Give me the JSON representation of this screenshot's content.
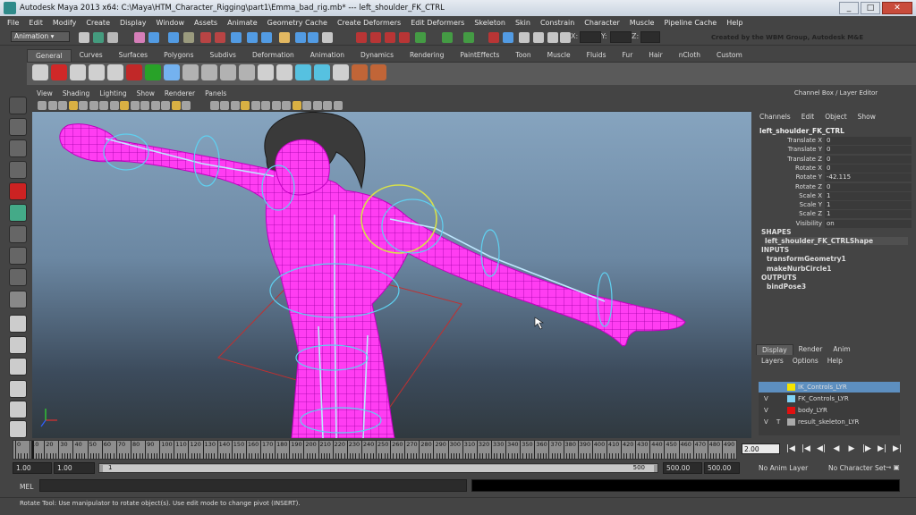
{
  "title": "Autodesk Maya 2013 x64: C:\\Maya\\HTM_Character_Rigging\\part1\\Emma_bad_rig.mb*   ---   left_shoulder_FK_CTRL",
  "menus": [
    "File",
    "Edit",
    "Modify",
    "Create",
    "Display",
    "Window",
    "Assets",
    "Animate",
    "Geometry Cache",
    "Create Deformers",
    "Edit Deformers",
    "Skeleton",
    "Skin",
    "Constrain",
    "Character",
    "Muscle",
    "Pipeline Cache",
    "Help"
  ],
  "status": {
    "mode": "Animation",
    "x_label": "X:",
    "y_label": "Y:",
    "z_label": "Z:",
    "credit": "Created by the WBM Group, Autodesk M&E"
  },
  "shelf_tabs": [
    "General",
    "Curves",
    "Surfaces",
    "Polygons",
    "Subdivs",
    "Deformation",
    "Animation",
    "Dynamics",
    "Rendering",
    "PaintEffects",
    "Toon",
    "Muscle",
    "Fluids",
    "Fur",
    "Hair",
    "nCloth",
    "Custom"
  ],
  "viewport_menu": [
    "View",
    "Shading",
    "Lighting",
    "Show",
    "Renderer",
    "Panels"
  ],
  "channel_box": {
    "title": "Channel Box / Layer Editor",
    "menu": [
      "Channels",
      "Edit",
      "Object",
      "Show"
    ],
    "object": "left_shoulder_FK_CTRL",
    "attributes": [
      {
        "name": "Translate X",
        "value": "0"
      },
      {
        "name": "Translate Y",
        "value": "0"
      },
      {
        "name": "Translate Z",
        "value": "0"
      },
      {
        "name": "Rotate X",
        "value": "0"
      },
      {
        "name": "Rotate Y",
        "value": "-42.115"
      },
      {
        "name": "Rotate Z",
        "value": "0"
      },
      {
        "name": "Scale X",
        "value": "1"
      },
      {
        "name": "Scale Y",
        "value": "1"
      },
      {
        "name": "Scale Z",
        "value": "1"
      },
      {
        "name": "Visibility",
        "value": "on"
      }
    ],
    "shapes_label": "SHAPES",
    "shape": "left_shoulder_FK_CTRLShape",
    "inputs_label": "INPUTS",
    "inputs": [
      "transformGeometry1",
      "makeNurbCircle1"
    ],
    "outputs_label": "OUTPUTS",
    "outputs": [
      "bindPose3"
    ]
  },
  "layer_editor": {
    "tabs": [
      "Display",
      "Render",
      "Anim"
    ],
    "menu": [
      "Layers",
      "Options",
      "Help"
    ],
    "layers": [
      {
        "vis": "",
        "type": "",
        "color": "#f5e400",
        "name": "IK_Controls_LYR"
      },
      {
        "vis": "V",
        "type": "",
        "color": "#7fd3f5",
        "name": "FK_Controls_LYR"
      },
      {
        "vis": "V",
        "type": "",
        "color": "#e01010",
        "name": "body_LYR"
      },
      {
        "vis": "V",
        "type": "T",
        "color": "#aaaaaa",
        "name": "result_skeleton_LYR"
      }
    ]
  },
  "timeline": {
    "ticks": [
      "0",
      "10",
      "20",
      "30",
      "40",
      "50",
      "60",
      "70",
      "80",
      "90",
      "100",
      "110",
      "120",
      "130",
      "140",
      "150",
      "160",
      "170",
      "180",
      "190",
      "200",
      "210",
      "220",
      "230",
      "240",
      "250",
      "260",
      "270",
      "280",
      "290",
      "300",
      "310",
      "320",
      "330",
      "340",
      "350",
      "360",
      "370",
      "380",
      "390",
      "400",
      "410",
      "420",
      "430",
      "440",
      "450",
      "460",
      "470",
      "480",
      "490"
    ],
    "current_frame": "2.00"
  },
  "range": {
    "start_outer": "1.00",
    "start_inner": "1.00",
    "bar_start": "1",
    "bar_end": "500",
    "end_inner": "500.00",
    "end_outer": "500.00",
    "anim_layer": "No Anim Layer",
    "char_set": "No Character Set"
  },
  "command": {
    "label": "MEL"
  },
  "help_line": "Rotate Tool: Use manipulator to rotate object(s). Use edit mode to change pivot (INSERT).",
  "colors": {
    "mesh": "#ff2bf0",
    "wire": "#c000c0",
    "ctrl_blue": "#5fd0f0",
    "ctrl_yellow": "#d8e04a",
    "ctrl_red": "#c03030"
  }
}
